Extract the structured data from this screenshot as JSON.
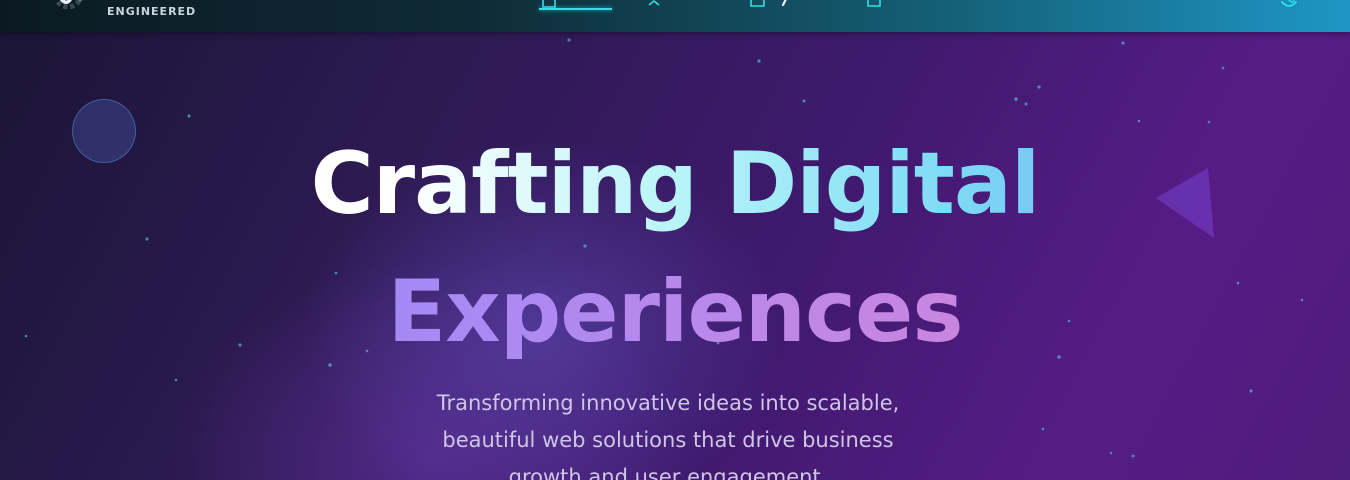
{
  "header": {
    "logo_text": "ENGINEERED",
    "nav_icons": [
      "home-icon",
      "user-icon",
      "briefcase-icon",
      "document-icon"
    ],
    "active_nav_index": 0,
    "theme_icon": "theme-toggle-icon"
  },
  "hero": {
    "title_line_1": "Crafting Digital",
    "title_line_2": "Experiences",
    "subtitle": "Transforming innovative ideas into scalable, beautiful web solutions that drive business growth and user engagement."
  },
  "colors": {
    "accent": "#2fe0e8",
    "headline_gradient_1": [
      "#ffffff",
      "#b8f4f8",
      "#5a8cf0"
    ],
    "headline_gradient_2": [
      "#8f84f5",
      "#e27fc7"
    ],
    "subtitle_text": "#cfc6e6"
  }
}
